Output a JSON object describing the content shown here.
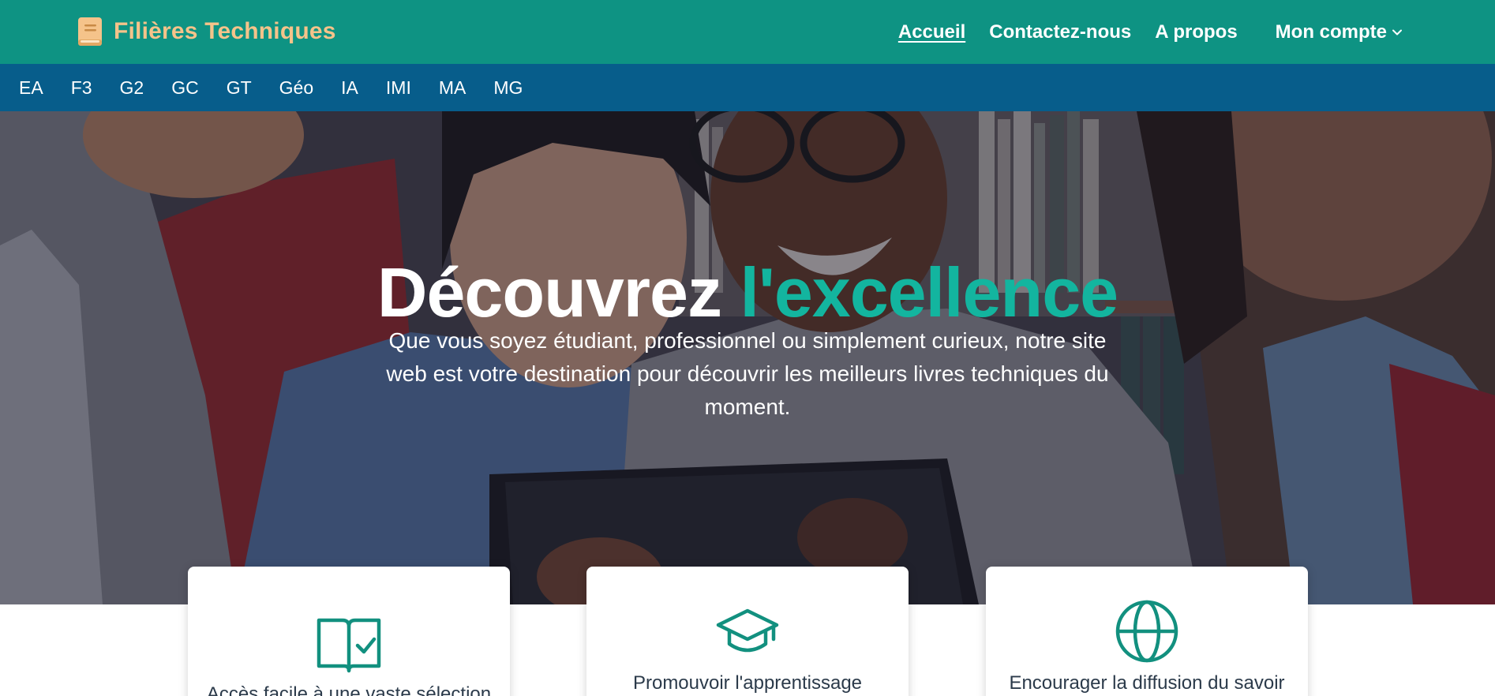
{
  "header": {
    "brand": "Filières Techniques",
    "nav": [
      {
        "label": "Accueil",
        "active": true
      },
      {
        "label": "Contactez-nous",
        "active": false
      },
      {
        "label": "A propos",
        "active": false
      }
    ],
    "account_label": "Mon compte"
  },
  "subnav": [
    "EA",
    "F3",
    "G2",
    "GC",
    "GT",
    "Géo",
    "IA",
    "IMI",
    "MA",
    "MG"
  ],
  "hero": {
    "title_main": "Découvrez",
    "title_accent": "l'excellence",
    "description": "Que vous soyez étudiant, professionnel ou simplement curieux, notre site web est votre destination pour découvrir les meilleurs livres techniques du moment."
  },
  "features": [
    {
      "icon": "book-check-icon",
      "label": "Accès facile à une vaste sélection"
    },
    {
      "icon": "graduation-cap-icon",
      "label": "Promouvoir l'apprentissage"
    },
    {
      "icon": "globe-icon",
      "label": "Encourager la diffusion du savoir"
    }
  ],
  "colors": {
    "topbar": "#0e9383",
    "subbar": "#075d8b",
    "brand": "#f5c38a",
    "accent": "#13b59f"
  }
}
